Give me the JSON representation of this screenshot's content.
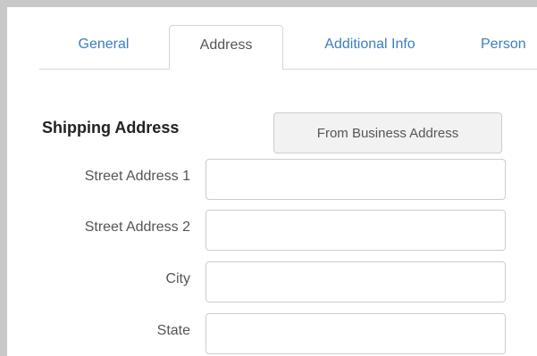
{
  "tabs": [
    {
      "label": "General",
      "active": false
    },
    {
      "label": "Address",
      "active": true
    },
    {
      "label": "Additional Info",
      "active": false
    },
    {
      "label": "Person",
      "active": false
    }
  ],
  "shipping": {
    "title": "Shipping Address",
    "from_business_label": "From Business Address",
    "fields": [
      {
        "label": "Street Address 1",
        "value": "",
        "placeholder": ""
      },
      {
        "label": "Street Address 2",
        "value": "",
        "placeholder": ""
      },
      {
        "label": "City",
        "value": "",
        "placeholder": ""
      },
      {
        "label": "State",
        "value": "",
        "placeholder": ""
      }
    ]
  },
  "colors": {
    "tab_link": "#3a7ebf",
    "active_tab_text": "#555555",
    "border": "#cccccc"
  }
}
